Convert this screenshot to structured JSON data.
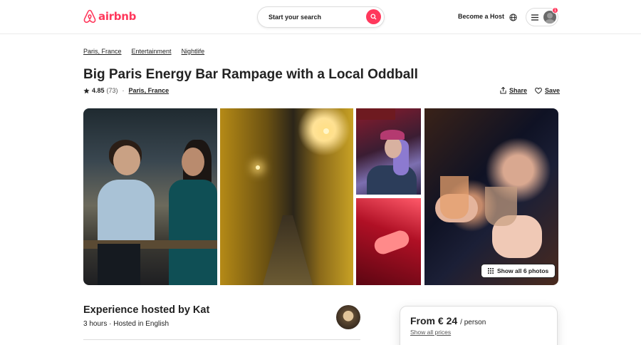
{
  "header": {
    "logo_text": "airbnb",
    "search_placeholder": "Start your search",
    "host_link": "Become a Host",
    "notification_count": "1"
  },
  "breadcrumb": [
    "Paris, France",
    "Entertainment",
    "Nightlife"
  ],
  "listing": {
    "title": "Big Paris Energy Bar Rampage with a Local Oddball",
    "rating": "4.85",
    "reviews": "(73)",
    "separator": "·",
    "location": "Paris, France",
    "share_label": "Share",
    "save_label": "Save"
  },
  "gallery": {
    "show_all_label": "Show all 6 photos"
  },
  "host": {
    "title": "Experience hosted by Kat",
    "subtitle": "3 hours · Hosted in English"
  },
  "booking": {
    "price_from": "From € 24",
    "price_unit": "/ person",
    "prices_link": "Show all prices"
  },
  "colors": {
    "brand": "#ff385c",
    "text": "#222222",
    "border": "#dddddd"
  }
}
